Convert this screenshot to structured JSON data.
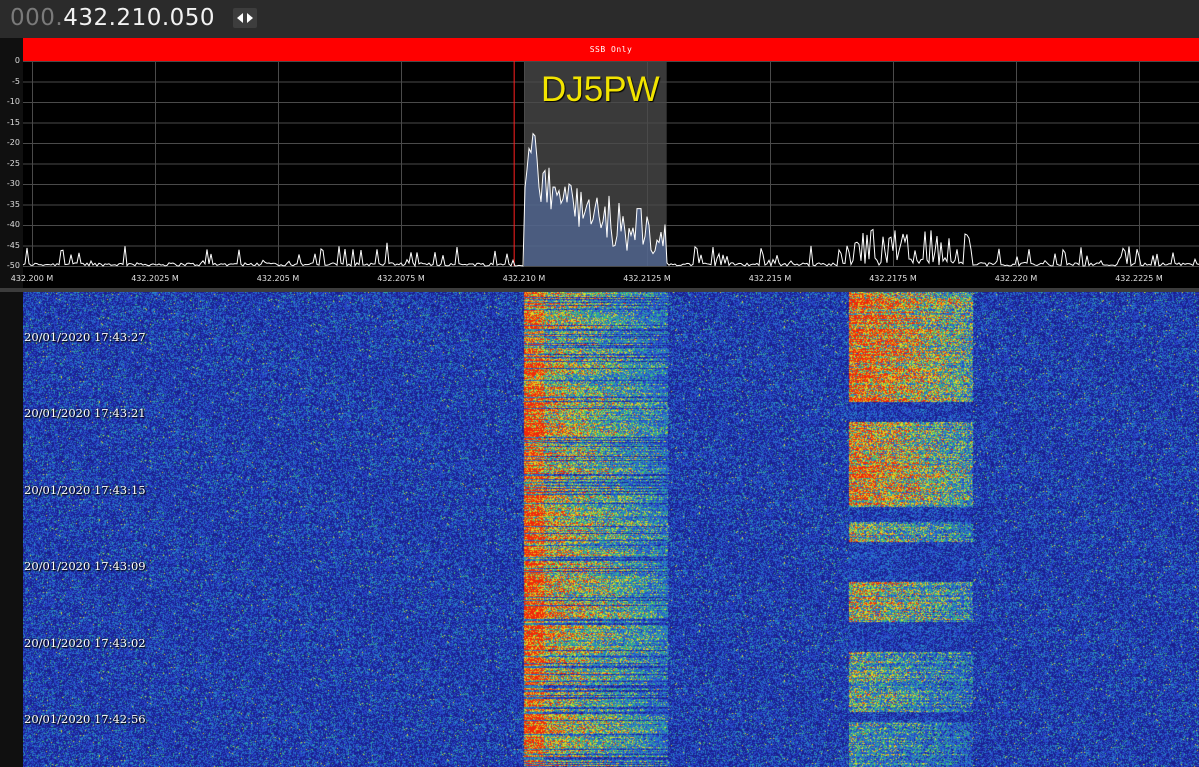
{
  "header": {
    "frequency_prefix": "000.",
    "frequency_main": "432.210.050",
    "tune_arrows_icon": "left-right-arrows-icon"
  },
  "banner": {
    "text": "SSB Only",
    "color": "#ff0000"
  },
  "spectrum": {
    "db_labels": [
      "0",
      "-5",
      "-10",
      "-15",
      "-20",
      "-25",
      "-30",
      "-35",
      "-40",
      "-45",
      "-50"
    ],
    "freq_labels": [
      "432.200 M",
      "432.2025 M",
      "432.205 M",
      "432.2075 M",
      "432.210 M",
      "432.2125 M",
      "432.215 M",
      "432.2175 M",
      "432.220 M",
      "432.2225 M"
    ],
    "freq_start_mhz": 432.2,
    "freq_step_mhz": 0.0025,
    "db_range": [
      -50,
      0
    ],
    "callsign": "DJ5PW",
    "callsign_color": "#f2e400",
    "passband_mhz": [
      432.21,
      432.2129
    ],
    "marker_mhz": 432.2098,
    "colors": {
      "grid": "#4a4a4a",
      "trace": "#ffffff",
      "passband": "#3a3a3a",
      "marker": "#ff2020"
    }
  },
  "waterfall": {
    "timestamps": [
      "20/01/2020 17:43:27",
      "20/01/2020 17:43:21",
      "20/01/2020 17:43:15",
      "20/01/2020 17:43:09",
      "20/01/2020 17:43:02",
      "20/01/2020 17:42:56"
    ],
    "signal_bands_mhz": [
      [
        432.21,
        432.2129
      ],
      [
        432.2166,
        432.2191
      ]
    ],
    "colors": {
      "background": "#1a1f8f",
      "noise": "#2c5bd8",
      "signal": "#e8e020",
      "peak": "#ff3000"
    }
  }
}
